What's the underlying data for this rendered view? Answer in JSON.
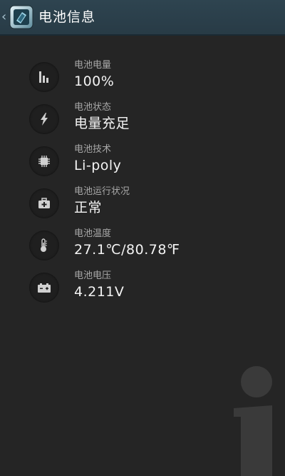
{
  "header": {
    "title": "电池信息",
    "back_glyph": "‹",
    "app_icon": "battery-app-icon"
  },
  "info": {
    "items": [
      {
        "label": "电池电量",
        "value": "100%",
        "icon": "battery-level-bars-icon"
      },
      {
        "label": "电池状态",
        "value": "电量充足",
        "icon": "lightning-bolt-icon"
      },
      {
        "label": "电池技术",
        "value": "Li-poly",
        "icon": "chip-icon"
      },
      {
        "label": "电池运行状况",
        "value": "正常",
        "icon": "medical-kit-icon"
      },
      {
        "label": "电池温度",
        "value": "27.1℃/80.78℉",
        "icon": "thermometer-icon"
      },
      {
        "label": "电池电压",
        "value": "4.211V",
        "icon": "battery-voltage-icon"
      }
    ]
  },
  "colors": {
    "background": "#252525",
    "action_bar": "#2b404b",
    "label": "#a8a8a8",
    "value": "#f4f4f4",
    "icon_glyph": "#d0d0d0"
  },
  "decor": {
    "watermark_icon": "info-i-icon"
  }
}
